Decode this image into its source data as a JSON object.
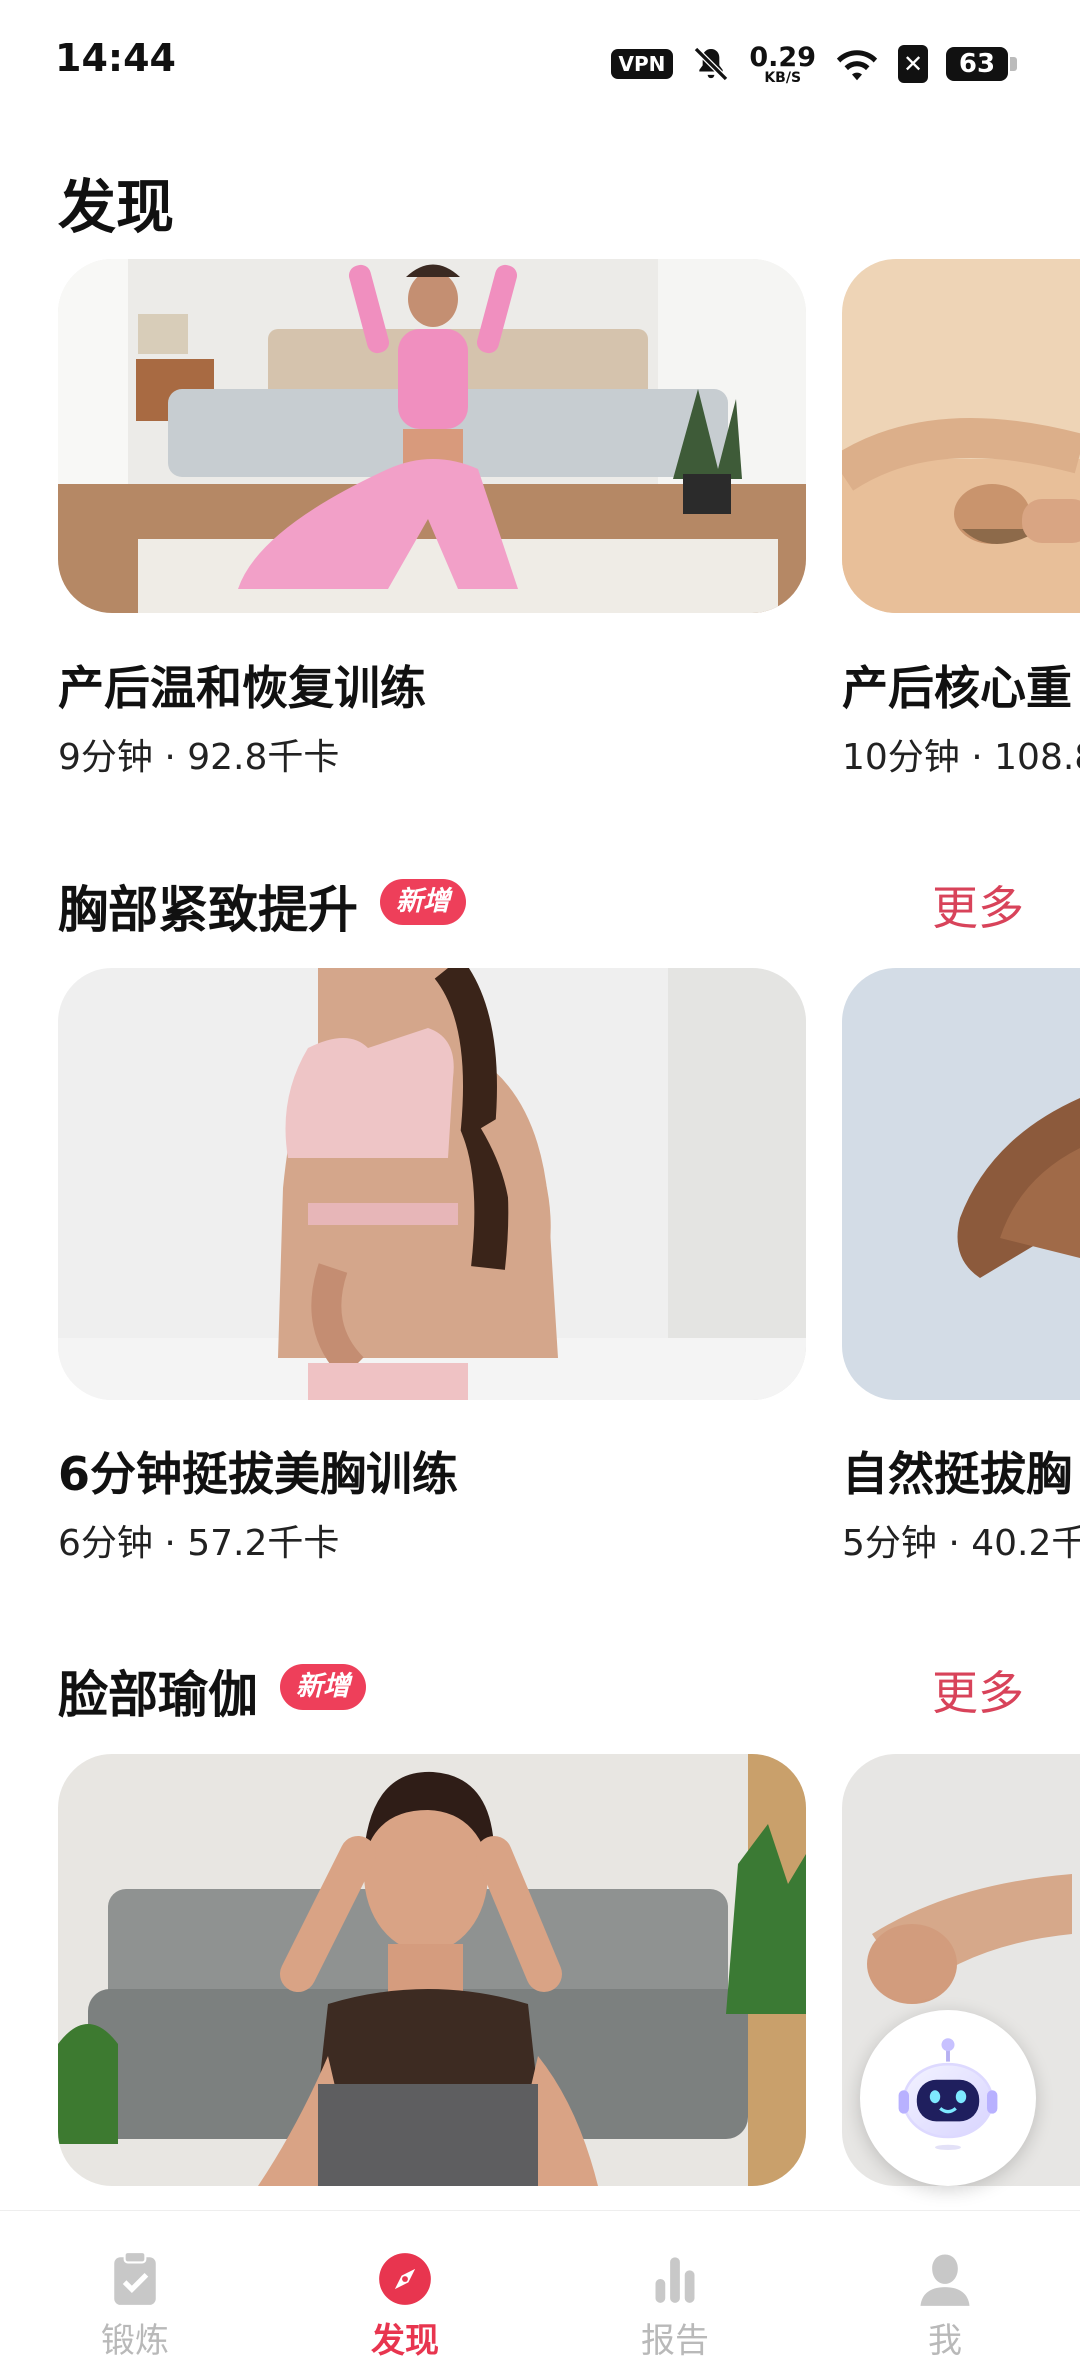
{
  "status_bar": {
    "time": "14:44",
    "vpn": "VPN",
    "net_speed": "0.29",
    "net_unit": "KB/S",
    "sim_symbol": "✕",
    "battery": "63",
    "icons": [
      "vpn-icon",
      "bell-off-icon",
      "wifi-icon",
      "sim-off-icon",
      "battery-icon"
    ]
  },
  "page": {
    "title": "发现"
  },
  "featured": [
    {
      "title": "产后温和恢复训练",
      "meta": "9分钟 · 92.8千卡"
    },
    {
      "title": "产后核心重",
      "meta": "10分钟 · 108.8"
    }
  ],
  "sections": [
    {
      "title": "胸部紧致提升",
      "badge": "新增",
      "more": "更多",
      "cards": [
        {
          "title": "6分钟挺拔美胸训练",
          "meta": "6分钟 · 57.2千卡"
        },
        {
          "title": "自然挺拔胸",
          "meta": "5分钟 · 40.2千"
        }
      ]
    },
    {
      "title": "脸部瑜伽",
      "badge": "新增",
      "more": "更多",
      "cards": [
        {
          "title": "",
          "meta": ""
        },
        {
          "title": "",
          "meta": ""
        }
      ]
    }
  ],
  "bottom_nav": [
    {
      "label": "锻炼",
      "icon": "clipboard-check-icon",
      "active": false
    },
    {
      "label": "发现",
      "icon": "compass-icon",
      "active": true
    },
    {
      "label": "报告",
      "icon": "bar-chart-icon",
      "active": false
    },
    {
      "label": "我",
      "icon": "user-icon",
      "active": false
    }
  ],
  "colors": {
    "accent": "#e8354f",
    "badge": "#ee3f5a",
    "more": "#d8435a",
    "inactive": "#b9b9b9"
  }
}
